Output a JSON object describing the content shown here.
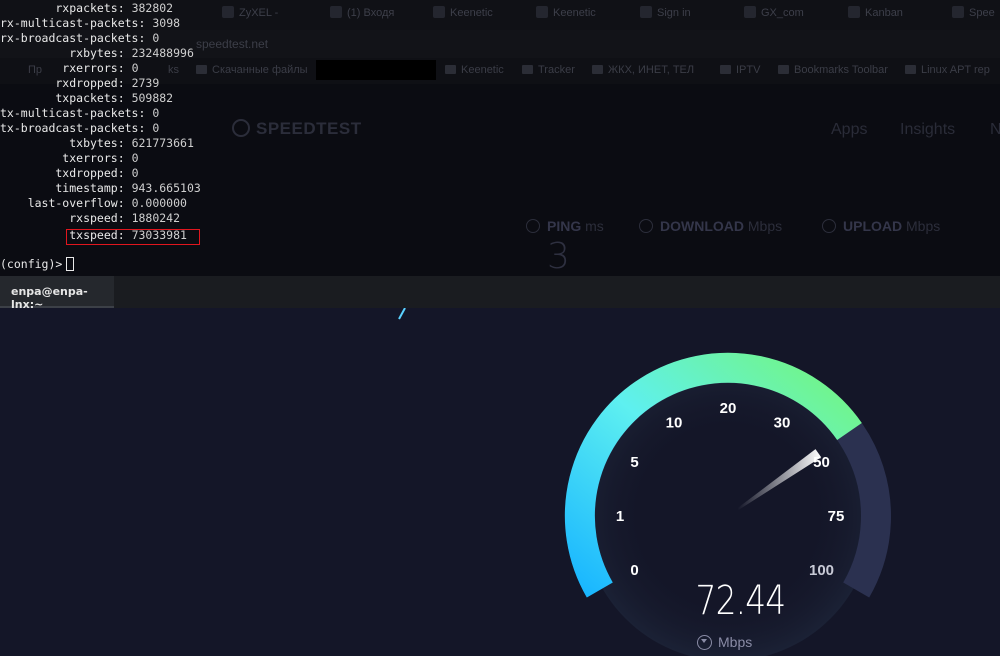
{
  "browser": {
    "tabs": [
      {
        "label": "ZyXEL -"
      },
      {
        "label": "(1) Входя"
      },
      {
        "label": "Keenetic"
      },
      {
        "label": "Keenetic"
      },
      {
        "label": "Sign in"
      },
      {
        "label": "GX_com"
      },
      {
        "label": "Kanban"
      },
      {
        "label": "Spee"
      }
    ],
    "url": "speedtest.net",
    "bookmarks": [
      {
        "label": "Пр"
      },
      {
        "label": "ks"
      },
      {
        "label": "Скачанные файлы"
      },
      {
        "label": "Keenetic"
      },
      {
        "label": "Tracker"
      },
      {
        "label": "ЖКХ, ИНЕТ, ТЕЛ"
      },
      {
        "label": "IPTV"
      },
      {
        "label": "Bookmarks Toolbar"
      },
      {
        "label": "Linux APT rep"
      }
    ],
    "logo": "SPEEDTEST",
    "nav": [
      "Apps",
      "Insights",
      "N"
    ],
    "metrics": [
      {
        "name": "PING",
        "unit": "ms"
      },
      {
        "name": "DOWNLOAD",
        "unit": "Mbps"
      },
      {
        "name": "UPLOAD",
        "unit": "Mbps"
      }
    ],
    "ping_value": "3"
  },
  "terminal": {
    "lines": [
      {
        "key": "        rxpackets:",
        "value": "382802"
      },
      {
        "key": "rx-multicast-packets:",
        "value": "3098"
      },
      {
        "key": "rx-broadcast-packets:",
        "value": "0"
      },
      {
        "key": "          rxbytes:",
        "value": "232488996"
      },
      {
        "key": "         rxerrors:",
        "value": "0"
      },
      {
        "key": "        rxdropped:",
        "value": "2739"
      },
      {
        "key": "        txpackets:",
        "value": "509882"
      },
      {
        "key": "tx-multicast-packets:",
        "value": "0"
      },
      {
        "key": "tx-broadcast-packets:",
        "value": "0"
      },
      {
        "key": "          txbytes:",
        "value": "621773661"
      },
      {
        "key": "         txerrors:",
        "value": "0"
      },
      {
        "key": "        txdropped:",
        "value": "0"
      },
      {
        "key": "        timestamp:",
        "value": "943.665103"
      },
      {
        "key": "    last-overflow:",
        "value": "0.000000"
      },
      {
        "key": "          rxspeed:",
        "value": "1880242"
      },
      {
        "key": "          txspeed:",
        "value": "73033981"
      }
    ],
    "prompt": "(config)>",
    "tab_title": "enpa@enpa-lnx:~"
  },
  "speedtest": {
    "ticks": [
      "0",
      "1",
      "5",
      "10",
      "20",
      "30",
      "50",
      "75",
      "100"
    ],
    "value": "72.44",
    "unit": "Mbps",
    "unit_icon": "download-arrow-icon",
    "gauge_fraction": 0.73,
    "colors": {
      "arc_start": "#19b6ff",
      "arc_mid": "#5ef0f0",
      "arc_end": "#74f57c",
      "track": "#2b3150",
      "bg": "#141628"
    }
  }
}
